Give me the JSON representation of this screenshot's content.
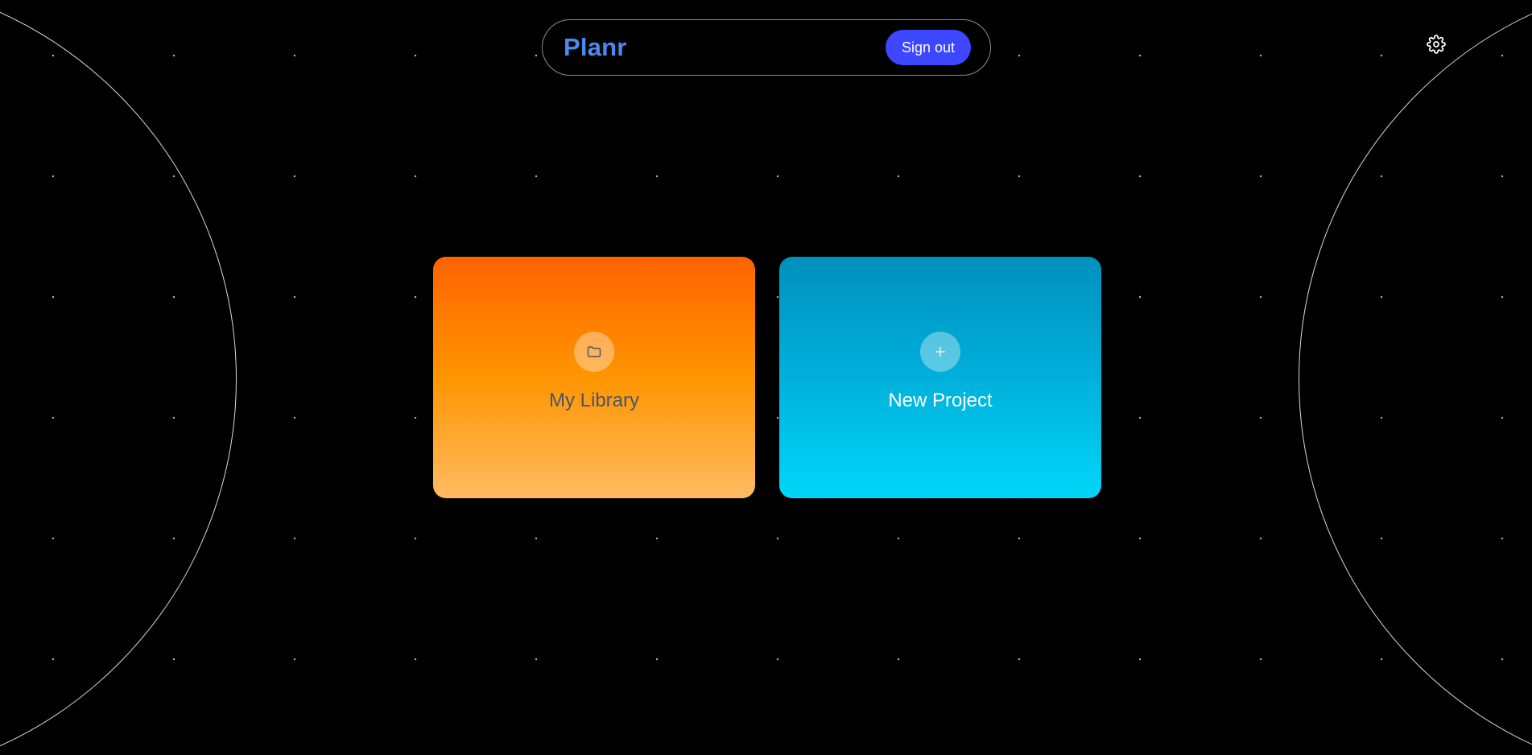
{
  "app": {
    "brand": "Planr"
  },
  "header": {
    "signout_label": "Sign out"
  },
  "icons": {
    "settings": "gear-icon",
    "library": "folder-icon",
    "new_project": "plus-icon"
  },
  "cards": [
    {
      "label": "My Library"
    },
    {
      "label": "New Project"
    }
  ],
  "colors": {
    "brand": "#4a8bf0",
    "signout_button": "#3d47ff",
    "library_gradient_top": "#ff6300",
    "library_gradient_bottom": "#ffbb62",
    "new_project_gradient_top": "#0090bd",
    "new_project_gradient_bottom": "#00d6f8",
    "background": "#000000"
  }
}
